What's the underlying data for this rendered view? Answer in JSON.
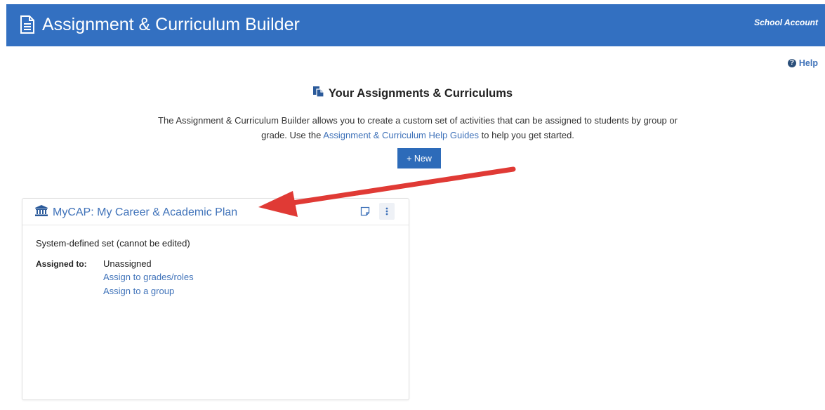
{
  "header": {
    "title": "Assignment & Curriculum Builder",
    "account_label": "School Account",
    "icon": "document-icon"
  },
  "help": {
    "label": "Help",
    "icon": "question-circle-icon"
  },
  "section": {
    "title": "Your Assignments & Curriculums",
    "icon": "copy-documents-icon",
    "intro_before": "The Assignment & Curriculum Builder allows you to create a custom set of activities that can be assigned to students by group or grade. Use the ",
    "intro_link": "Assignment & Curriculum Help Guides",
    "intro_after": " to help you get started.",
    "new_button": "+ New"
  },
  "card": {
    "title": "MyCAP: My Career & Academic Plan",
    "title_icon": "institution-icon",
    "description": "System-defined set (cannot be edited)",
    "assigned_label": "Assigned to:",
    "assigned_value": "Unassigned",
    "assign_grades_link": "Assign to grades/roles",
    "assign_group_link": "Assign to a group"
  },
  "colors": {
    "header_bg": "#3370c1",
    "link": "#3f72b9",
    "button_bg": "#2d6bb9",
    "annotation_arrow": "#e03a35"
  }
}
